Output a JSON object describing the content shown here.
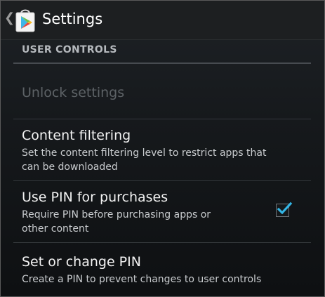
{
  "action_bar": {
    "up_glyph": "❮",
    "app_icon": "play-store-icon",
    "title": "Settings"
  },
  "section": {
    "header": "USER CONTROLS"
  },
  "preferences": [
    {
      "title": "Unlock settings",
      "summary": "",
      "enabled": false
    },
    {
      "title": "Content filtering",
      "summary_line1": "Set the content filtering level to restrict apps that",
      "summary_line2": "can be downloaded",
      "enabled": true
    },
    {
      "title": "Use PIN for purchases",
      "summary_line1": "Require PIN before purchasing apps or",
      "summary_line2": "other content",
      "enabled": true,
      "checked": true
    },
    {
      "title": "Set or change PIN",
      "summary_line1": "Create a PIN to prevent changes to user controls",
      "enabled": true
    }
  ],
  "colors": {
    "accent": "#33b5e5",
    "background": "#16191c"
  }
}
